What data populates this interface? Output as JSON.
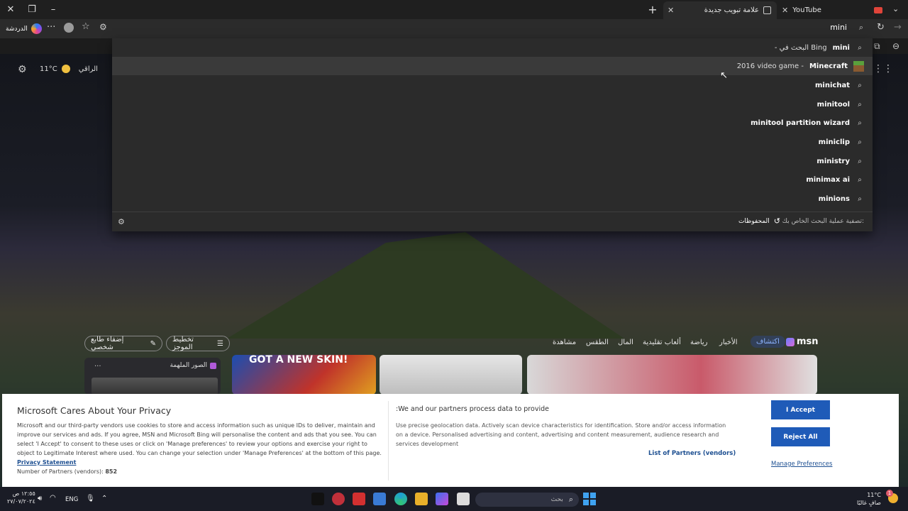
{
  "titlebar": {
    "tabs": [
      {
        "label": "علامة تبويب جديدة",
        "active": true
      },
      {
        "label": "YouTube",
        "active": false
      }
    ]
  },
  "toolbar": {
    "profile_label": "الدردشة",
    "address_text": "mini"
  },
  "dropdown": {
    "suggestions": [
      {
        "bold": "mini",
        "rest": " - البحث في Bing",
        "highlighted": false,
        "kind": "search"
      },
      {
        "bold": "Minecraft",
        "rest": "2016 video game - ",
        "highlighted": true,
        "kind": "entity"
      },
      {
        "bold": "minichat",
        "rest": "",
        "highlighted": false,
        "kind": "search"
      },
      {
        "bold": "minitool",
        "rest": "",
        "highlighted": false,
        "kind": "search"
      },
      {
        "bold": "minitool partition wizard",
        "rest": "",
        "highlighted": false,
        "kind": "search"
      },
      {
        "bold": "miniclip",
        "rest": "",
        "highlighted": false,
        "kind": "search"
      },
      {
        "bold": "ministry",
        "rest": "",
        "highlighted": false,
        "kind": "search"
      },
      {
        "bold": "minimax ai",
        "rest": "",
        "highlighted": false,
        "kind": "search"
      },
      {
        "bold": "minions",
        "rest": "",
        "highlighted": false,
        "kind": "search"
      }
    ],
    "footer_filter_label": "تصفية عملية البحث الخاص بك:",
    "footer_saved_label": "المحفوظات"
  },
  "page": {
    "weather_location": "الراقي",
    "weather_temp": "11°C",
    "msn_logo": "msn",
    "nav": [
      "اكتشاف",
      "الأخبار",
      "رياضة",
      "ألعاب تقليدية",
      "المال",
      "الطقس",
      "مشاهدة"
    ],
    "personalize_label": "إضفاء طابع شخصي",
    "feed_layout_label": "تخطيط الموجز",
    "inspiring_images_label": "الصور الملهمة",
    "more_dots": "...",
    "card_headline": "GOT A NEW SKIN!"
  },
  "consent": {
    "title": "Microsoft Cares About Your Privacy",
    "body": "Microsoft and our third-party vendors use cookies to store and access information such as unique IDs to deliver, maintain and improve our services and ads. If you agree, MSN and Microsoft Bing will personalise the content and ads that you see. You can select 'I Accept' to consent to these uses or click on 'Manage preferences' to review your options and exercise your right to object to Legitimate Interest where used. You can change your selection under 'Manage Preferences' at the bottom of this page.",
    "privacy_link": "Privacy Statement",
    "vendors_count_label": "Number of Partners (vendors):",
    "vendors_count": "852",
    "process_title": ":We and our partners process data to provide",
    "process_body": "Use precise geolocation data. Actively scan device characteristics for identification. Store and/or access information on a device. Personalised advertising and content, advertising and content measurement, audience research and services development",
    "partners_link": "List of Partners (vendors)",
    "accept_label": "I Accept",
    "reject_label": "Reject All",
    "manage_label": "Manage Preferences"
  },
  "taskbar": {
    "time": "١٢:٥٥ ص",
    "date": "٢٧/٠٧/٢٠٢٤",
    "language": "ENG",
    "search_placeholder": "بحث",
    "weather_temp": "11°C",
    "weather_desc": "صافٍ غالبًا",
    "notification_badge": "1"
  }
}
